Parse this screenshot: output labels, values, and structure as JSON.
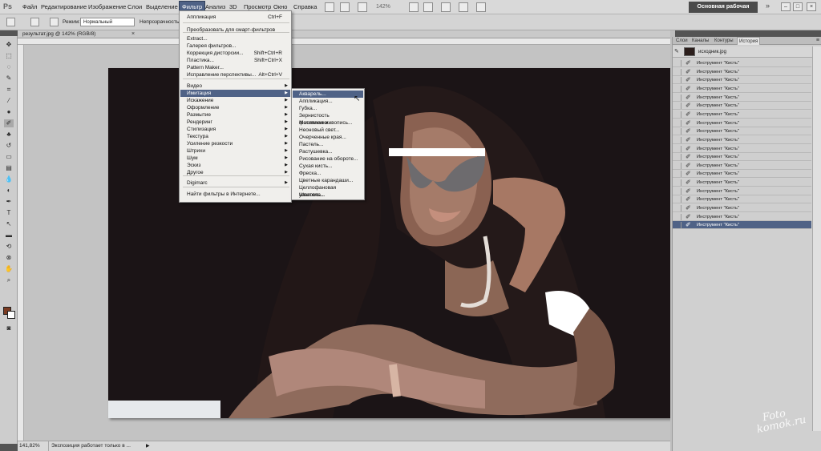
{
  "app": {
    "logo": "Ps"
  },
  "menubar": {
    "items": [
      "Файл",
      "Редактирование",
      "Изображение",
      "Слои",
      "Выделение",
      "Фильтр",
      "Анализ",
      "3D",
      "Просмотр",
      "Окно",
      "Справка"
    ],
    "active": "Фильтр",
    "zoom": "142%",
    "workspace": "Основная рабочая среда",
    "workspace_more": "»"
  },
  "options": {
    "mode_label": "Режим:",
    "mode_value": "Нормальный",
    "opacity_label": "Непрозрачность:"
  },
  "document": {
    "tab_title": "результат.jpg @ 142% (RGB/8)",
    "close": "×"
  },
  "status": {
    "zoom": "141,82%",
    "text": "Экспозиция работает только в ...",
    "arrow": "▶"
  },
  "filter_menu": {
    "items": [
      {
        "label": "Аппликация",
        "shortcut": "Ctrl+F"
      },
      {
        "label": "Преобразовать для смарт-фильтров"
      },
      {
        "label": "Extract..."
      },
      {
        "label": "Галерея фильтров..."
      },
      {
        "label": "Коррекция дисторсии...",
        "shortcut": "Shift+Ctrl+R"
      },
      {
        "label": "Пластика...",
        "shortcut": "Shift+Ctrl+X"
      },
      {
        "label": "Pattern Maker..."
      },
      {
        "label": "Исправление перспективы...",
        "shortcut": "Alt+Ctrl+V"
      },
      {
        "label": "Видео",
        "submenu": true
      },
      {
        "label": "Имитация",
        "submenu": true,
        "highlighted": true
      },
      {
        "label": "Искажение",
        "submenu": true
      },
      {
        "label": "Оформление",
        "submenu": true
      },
      {
        "label": "Размытие",
        "submenu": true
      },
      {
        "label": "Рендеринг",
        "submenu": true
      },
      {
        "label": "Стилизация",
        "submenu": true
      },
      {
        "label": "Текстура",
        "submenu": true
      },
      {
        "label": "Усиление резкости",
        "submenu": true
      },
      {
        "label": "Штрихи",
        "submenu": true
      },
      {
        "label": "Шум",
        "submenu": true
      },
      {
        "label": "Эскиз",
        "submenu": true
      },
      {
        "label": "Другое",
        "submenu": true
      },
      {
        "label": "Digimarc",
        "submenu": true
      },
      {
        "label": "Найти фильтры в Интернете..."
      }
    ]
  },
  "imitation_submenu": {
    "items": [
      "Акварель...",
      "Аппликация...",
      "Губка...",
      "Зернистость фотопленки...",
      "Масляная живопись...",
      "Неоновый свет...",
      "Очерченные края...",
      "Пастель...",
      "Растушевка...",
      "Рисование на обороте...",
      "Сухая кисть...",
      "Фреска...",
      "Цветные карандаши...",
      "Целлофановая упаковка...",
      "Шпатель..."
    ],
    "highlighted_index": 0
  },
  "panel": {
    "tabs": [
      "Слои",
      "Каналы",
      "Контуры",
      "История"
    ],
    "active_tab": "История",
    "menu_icon": "≡",
    "snapshot_label": "исходник.jpg",
    "history_items": [
      "Инструмент \"Кисть\"",
      "Инструмент \"Кисть\"",
      "Инструмент \"Кисть\"",
      "Инструмент \"Кисть\"",
      "Инструмент \"Кисть\"",
      "Инструмент \"Кисть\"",
      "Инструмент \"Кисть\"",
      "Инструмент \"Кисть\"",
      "Инструмент \"Кисть\"",
      "Инструмент \"Кисть\"",
      "Инструмент \"Кисть\"",
      "Инструмент \"Кисть\"",
      "Инструмент \"Кисть\"",
      "Инструмент \"Кисть\"",
      "Инструмент \"Кисть\"",
      "Инструмент \"Кисть\"",
      "Инструмент \"Кисть\"",
      "Инструмент \"Кисть\"",
      "Инструмент \"Кисть\"",
      "Инструмент \"Кисть\""
    ],
    "selected_index": 19
  },
  "watermark": {
    "line1": "Foto",
    "line2": "komok.ru"
  },
  "colors": {
    "accent": "#4f6286",
    "foreground": "#7b3b22",
    "background": "#ffffff"
  }
}
